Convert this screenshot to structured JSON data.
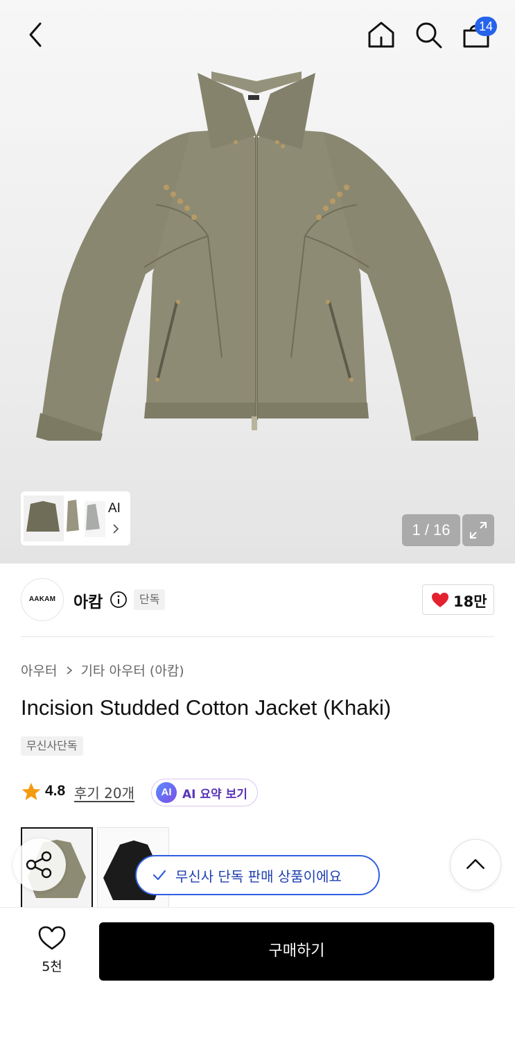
{
  "header": {
    "cart_count": "14"
  },
  "gallery": {
    "page_counter": "1 / 16",
    "ai_label": "AI"
  },
  "brand": {
    "logo_text": "AAKAM",
    "name": "아캄",
    "exclusive_badge": "단독",
    "like_count": "18만"
  },
  "product": {
    "breadcrumb": [
      "아우터",
      "기타 아우터 (아캄)"
    ],
    "title": "Incision Studded Cotton Jacket (Khaki)",
    "badge": "무신사단독",
    "rating": "4.8",
    "reviews": "후기 20개",
    "ai_summary_icon": "AI",
    "ai_summary": "AI 요약 보기"
  },
  "toast": {
    "message": "무신사 단독 판매 상품이에요"
  },
  "bottom": {
    "wish_count": "5천",
    "buy_label": "구매하기"
  },
  "colors": {
    "accent_blue": "#2563eb",
    "heart_red": "#e4212f",
    "star_orange": "#f59b10",
    "jacket_khaki": "#8b8872"
  },
  "icons": [
    "back-icon",
    "home-icon",
    "search-icon",
    "cart-icon",
    "expand-icon",
    "info-icon",
    "heart-icon",
    "star-icon",
    "share-icon",
    "check-icon",
    "chevron-up-icon"
  ]
}
